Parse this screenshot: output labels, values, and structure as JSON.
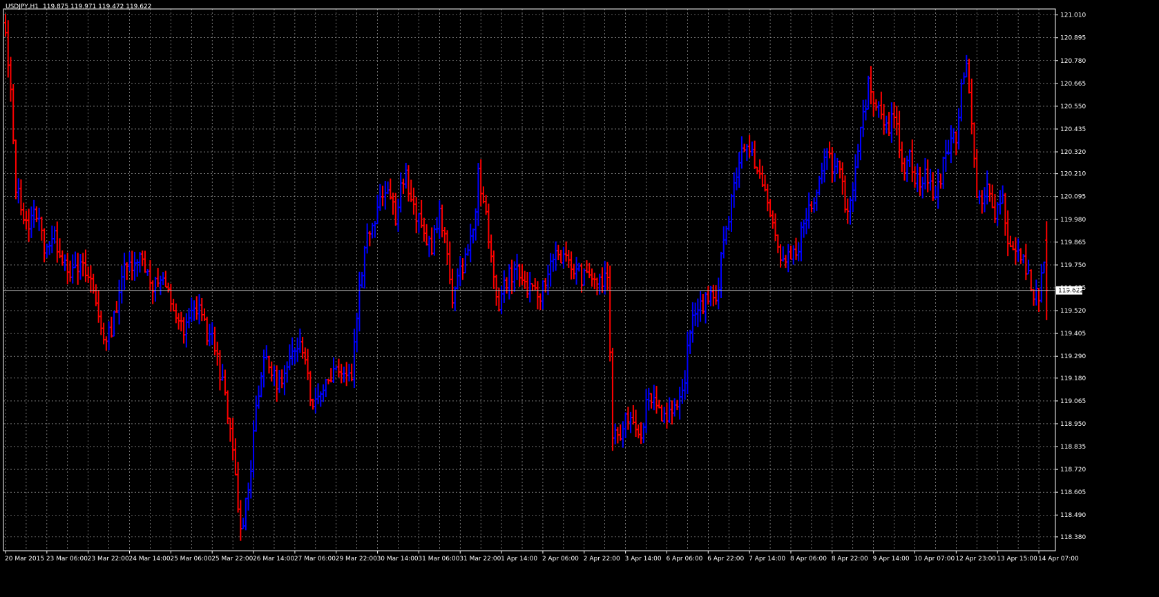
{
  "header": {
    "symbol": "USDJPY,H1",
    "ohlc": "119.875 119.971 119.472 119.622"
  },
  "colors": {
    "background": "#000000",
    "grid": "#c0c0c0",
    "axis": "#ffffff",
    "bull": "#0000ff",
    "bear": "#ff0000",
    "current_line": "#c0c0c0",
    "price_box": "#ffffff"
  },
  "current_price": 119.622,
  "chart_data": {
    "type": "bar",
    "style": "OHLC bars (H1), bullish bars blue, bearish bars red",
    "title": "USDJPY,H1",
    "ylim": [
      118.31,
      121.04
    ],
    "y_ticks": [
      121.01,
      120.895,
      120.78,
      120.665,
      120.55,
      120.435,
      120.32,
      120.21,
      120.095,
      119.98,
      119.865,
      119.75,
      119.635,
      119.52,
      119.405,
      119.29,
      119.18,
      119.065,
      118.95,
      118.835,
      118.72,
      118.605,
      118.49,
      118.38
    ],
    "y_tick_labels": [
      "121.010",
      "120.895",
      "120.780",
      "120.665",
      "120.550",
      "120.435",
      "120.320",
      "120.210",
      "120.095",
      "119.980",
      "119.865",
      "119.750",
      "119.635",
      "119.520",
      "119.405",
      "119.290",
      "119.180",
      "119.065",
      "118.950",
      "118.835",
      "118.720",
      "118.605",
      "118.490",
      "118.380"
    ],
    "x_tick_labels": [
      "20 Mar 2015",
      "23 Mar 06:00",
      "23 Mar 22:00",
      "24 Mar 14:00",
      "25 Mar 06:00",
      "25 Mar 22:00",
      "26 Mar 14:00",
      "27 Mar 06:00",
      "29 Mar 22:00",
      "30 Mar 14:00",
      "31 Mar 06:00",
      "31 Mar 22:00",
      "1 Apr 14:00",
      "2 Apr 06:00",
      "2 Apr 22:00",
      "3 Apr 14:00",
      "6 Apr 06:00",
      "6 Apr 22:00",
      "7 Apr 14:00",
      "8 Apr 06:00",
      "8 Apr 22:00",
      "9 Apr 14:00",
      "10 Apr 07:00",
      "12 Apr 23:00",
      "13 Apr 15:00",
      "14 Apr 07:00"
    ],
    "x_tick_positions_bar_index": [
      0,
      16,
      32,
      48,
      64,
      80,
      96,
      112,
      128,
      144,
      160,
      176,
      192,
      208,
      224,
      240,
      256,
      272,
      288,
      304,
      320,
      336,
      352,
      368,
      384,
      400
    ],
    "grid": true,
    "anchors": [
      [
        0,
        120.9
      ],
      [
        2,
        120.6
      ],
      [
        4,
        120.15
      ],
      [
        6,
        120.05
      ],
      [
        9,
        119.95
      ],
      [
        12,
        120.02
      ],
      [
        15,
        119.85
      ],
      [
        19,
        119.88
      ],
      [
        22,
        119.8
      ],
      [
        26,
        119.7
      ],
      [
        29,
        119.74
      ],
      [
        33,
        119.67
      ],
      [
        36,
        119.5
      ],
      [
        39,
        119.35
      ],
      [
        42,
        119.48
      ],
      [
        45,
        119.7
      ],
      [
        48,
        119.75
      ],
      [
        51,
        119.8
      ],
      [
        54,
        119.75
      ],
      [
        57,
        119.65
      ],
      [
        60,
        119.67
      ],
      [
        63,
        119.6
      ],
      [
        66,
        119.5
      ],
      [
        69,
        119.4
      ],
      [
        72,
        119.5
      ],
      [
        75,
        119.55
      ],
      [
        78,
        119.4
      ],
      [
        81,
        119.35
      ],
      [
        84,
        119.15
      ],
      [
        87,
        118.9
      ],
      [
        89,
        118.68
      ],
      [
        91,
        118.4
      ],
      [
        93,
        118.55
      ],
      [
        95,
        118.75
      ],
      [
        97,
        119.05
      ],
      [
        99,
        119.2
      ],
      [
        101,
        119.28
      ],
      [
        104,
        119.18
      ],
      [
        107,
        119.15
      ],
      [
        110,
        119.25
      ],
      [
        112,
        119.3
      ],
      [
        114,
        119.4
      ],
      [
        116,
        119.3
      ],
      [
        118,
        119.1
      ],
      [
        120,
        119.05
      ],
      [
        123,
        119.15
      ],
      [
        126,
        119.2
      ],
      [
        129,
        119.25
      ],
      [
        132,
        119.2
      ],
      [
        134,
        119.2
      ],
      [
        137,
        119.65
      ],
      [
        140,
        119.9
      ],
      [
        143,
        120.0
      ],
      [
        145,
        120.1
      ],
      [
        147,
        120.15
      ],
      [
        149,
        120.1
      ],
      [
        151,
        120.0
      ],
      [
        153,
        120.15
      ],
      [
        155,
        120.2
      ],
      [
        157,
        120.05
      ],
      [
        159,
        120.0
      ],
      [
        162,
        119.9
      ],
      [
        165,
        119.85
      ],
      [
        168,
        120.0
      ],
      [
        171,
        119.8
      ],
      [
        173,
        119.6
      ],
      [
        176,
        119.7
      ],
      [
        179,
        119.85
      ],
      [
        181,
        119.9
      ],
      [
        183,
        120.2
      ],
      [
        185,
        120.1
      ],
      [
        187,
        119.85
      ],
      [
        189,
        119.7
      ],
      [
        191,
        119.55
      ],
      [
        193,
        119.65
      ],
      [
        195,
        119.7
      ],
      [
        198,
        119.72
      ],
      [
        201,
        119.65
      ],
      [
        204,
        119.6
      ],
      [
        207,
        119.6
      ],
      [
        210,
        119.7
      ],
      [
        212,
        119.82
      ],
      [
        215,
        119.8
      ],
      [
        218,
        119.75
      ],
      [
        221,
        119.72
      ],
      [
        224,
        119.68
      ],
      [
        227,
        119.7
      ],
      [
        230,
        119.65
      ],
      [
        233,
        119.7
      ],
      [
        235,
        118.9
      ],
      [
        237,
        118.85
      ],
      [
        239,
        118.95
      ],
      [
        241,
        119.0
      ],
      [
        244,
        118.95
      ],
      [
        246,
        118.9
      ],
      [
        248,
        119.05
      ],
      [
        250,
        119.1
      ],
      [
        252,
        119.05
      ],
      [
        254,
        119.0
      ],
      [
        257,
        119.0
      ],
      [
        260,
        119.0
      ],
      [
        262,
        119.1
      ],
      [
        264,
        119.3
      ],
      [
        266,
        119.5
      ],
      [
        268,
        119.55
      ],
      [
        270,
        119.55
      ],
      [
        272,
        119.6
      ],
      [
        274,
        119.55
      ],
      [
        276,
        119.65
      ],
      [
        278,
        119.9
      ],
      [
        280,
        120.0
      ],
      [
        282,
        120.15
      ],
      [
        284,
        120.3
      ],
      [
        286,
        120.35
      ],
      [
        288,
        120.3
      ],
      [
        290,
        120.28
      ],
      [
        292,
        120.2
      ],
      [
        294,
        120.1
      ],
      [
        296,
        120.0
      ],
      [
        298,
        119.9
      ],
      [
        300,
        119.8
      ],
      [
        302,
        119.75
      ],
      [
        304,
        119.8
      ],
      [
        306,
        119.82
      ],
      [
        308,
        119.9
      ],
      [
        310,
        120.0
      ],
      [
        312,
        120.05
      ],
      [
        314,
        120.1
      ],
      [
        316,
        120.2
      ],
      [
        318,
        120.3
      ],
      [
        320,
        120.25
      ],
      [
        322,
        120.3
      ],
      [
        324,
        120.15
      ],
      [
        326,
        120.0
      ],
      [
        328,
        120.1
      ],
      [
        330,
        120.3
      ],
      [
        332,
        120.5
      ],
      [
        334,
        120.65
      ],
      [
        336,
        120.6
      ],
      [
        338,
        120.55
      ],
      [
        340,
        120.5
      ],
      [
        342,
        120.45
      ],
      [
        344,
        120.5
      ],
      [
        346,
        120.35
      ],
      [
        348,
        120.25
      ],
      [
        350,
        120.3
      ],
      [
        352,
        120.2
      ],
      [
        354,
        120.15
      ],
      [
        356,
        120.2
      ],
      [
        358,
        120.15
      ],
      [
        360,
        120.1
      ],
      [
        362,
        120.2
      ],
      [
        364,
        120.3
      ],
      [
        366,
        120.4
      ],
      [
        368,
        120.35
      ],
      [
        370,
        120.7
      ],
      [
        372,
        120.75
      ],
      [
        374,
        120.5
      ],
      [
        376,
        120.1
      ],
      [
        378,
        120.05
      ],
      [
        380,
        120.15
      ],
      [
        382,
        120.0
      ],
      [
        384,
        120.05
      ],
      [
        386,
        120.1
      ],
      [
        388,
        119.9
      ],
      [
        390,
        119.8
      ],
      [
        392,
        119.85
      ],
      [
        394,
        119.75
      ],
      [
        396,
        119.7
      ],
      [
        398,
        119.62
      ],
      [
        400,
        119.6
      ],
      [
        402,
        119.75
      ],
      [
        403,
        119.622
      ]
    ],
    "last_bar": {
      "open": 119.875,
      "high": 119.971,
      "low": 119.472,
      "close": 119.622
    }
  }
}
